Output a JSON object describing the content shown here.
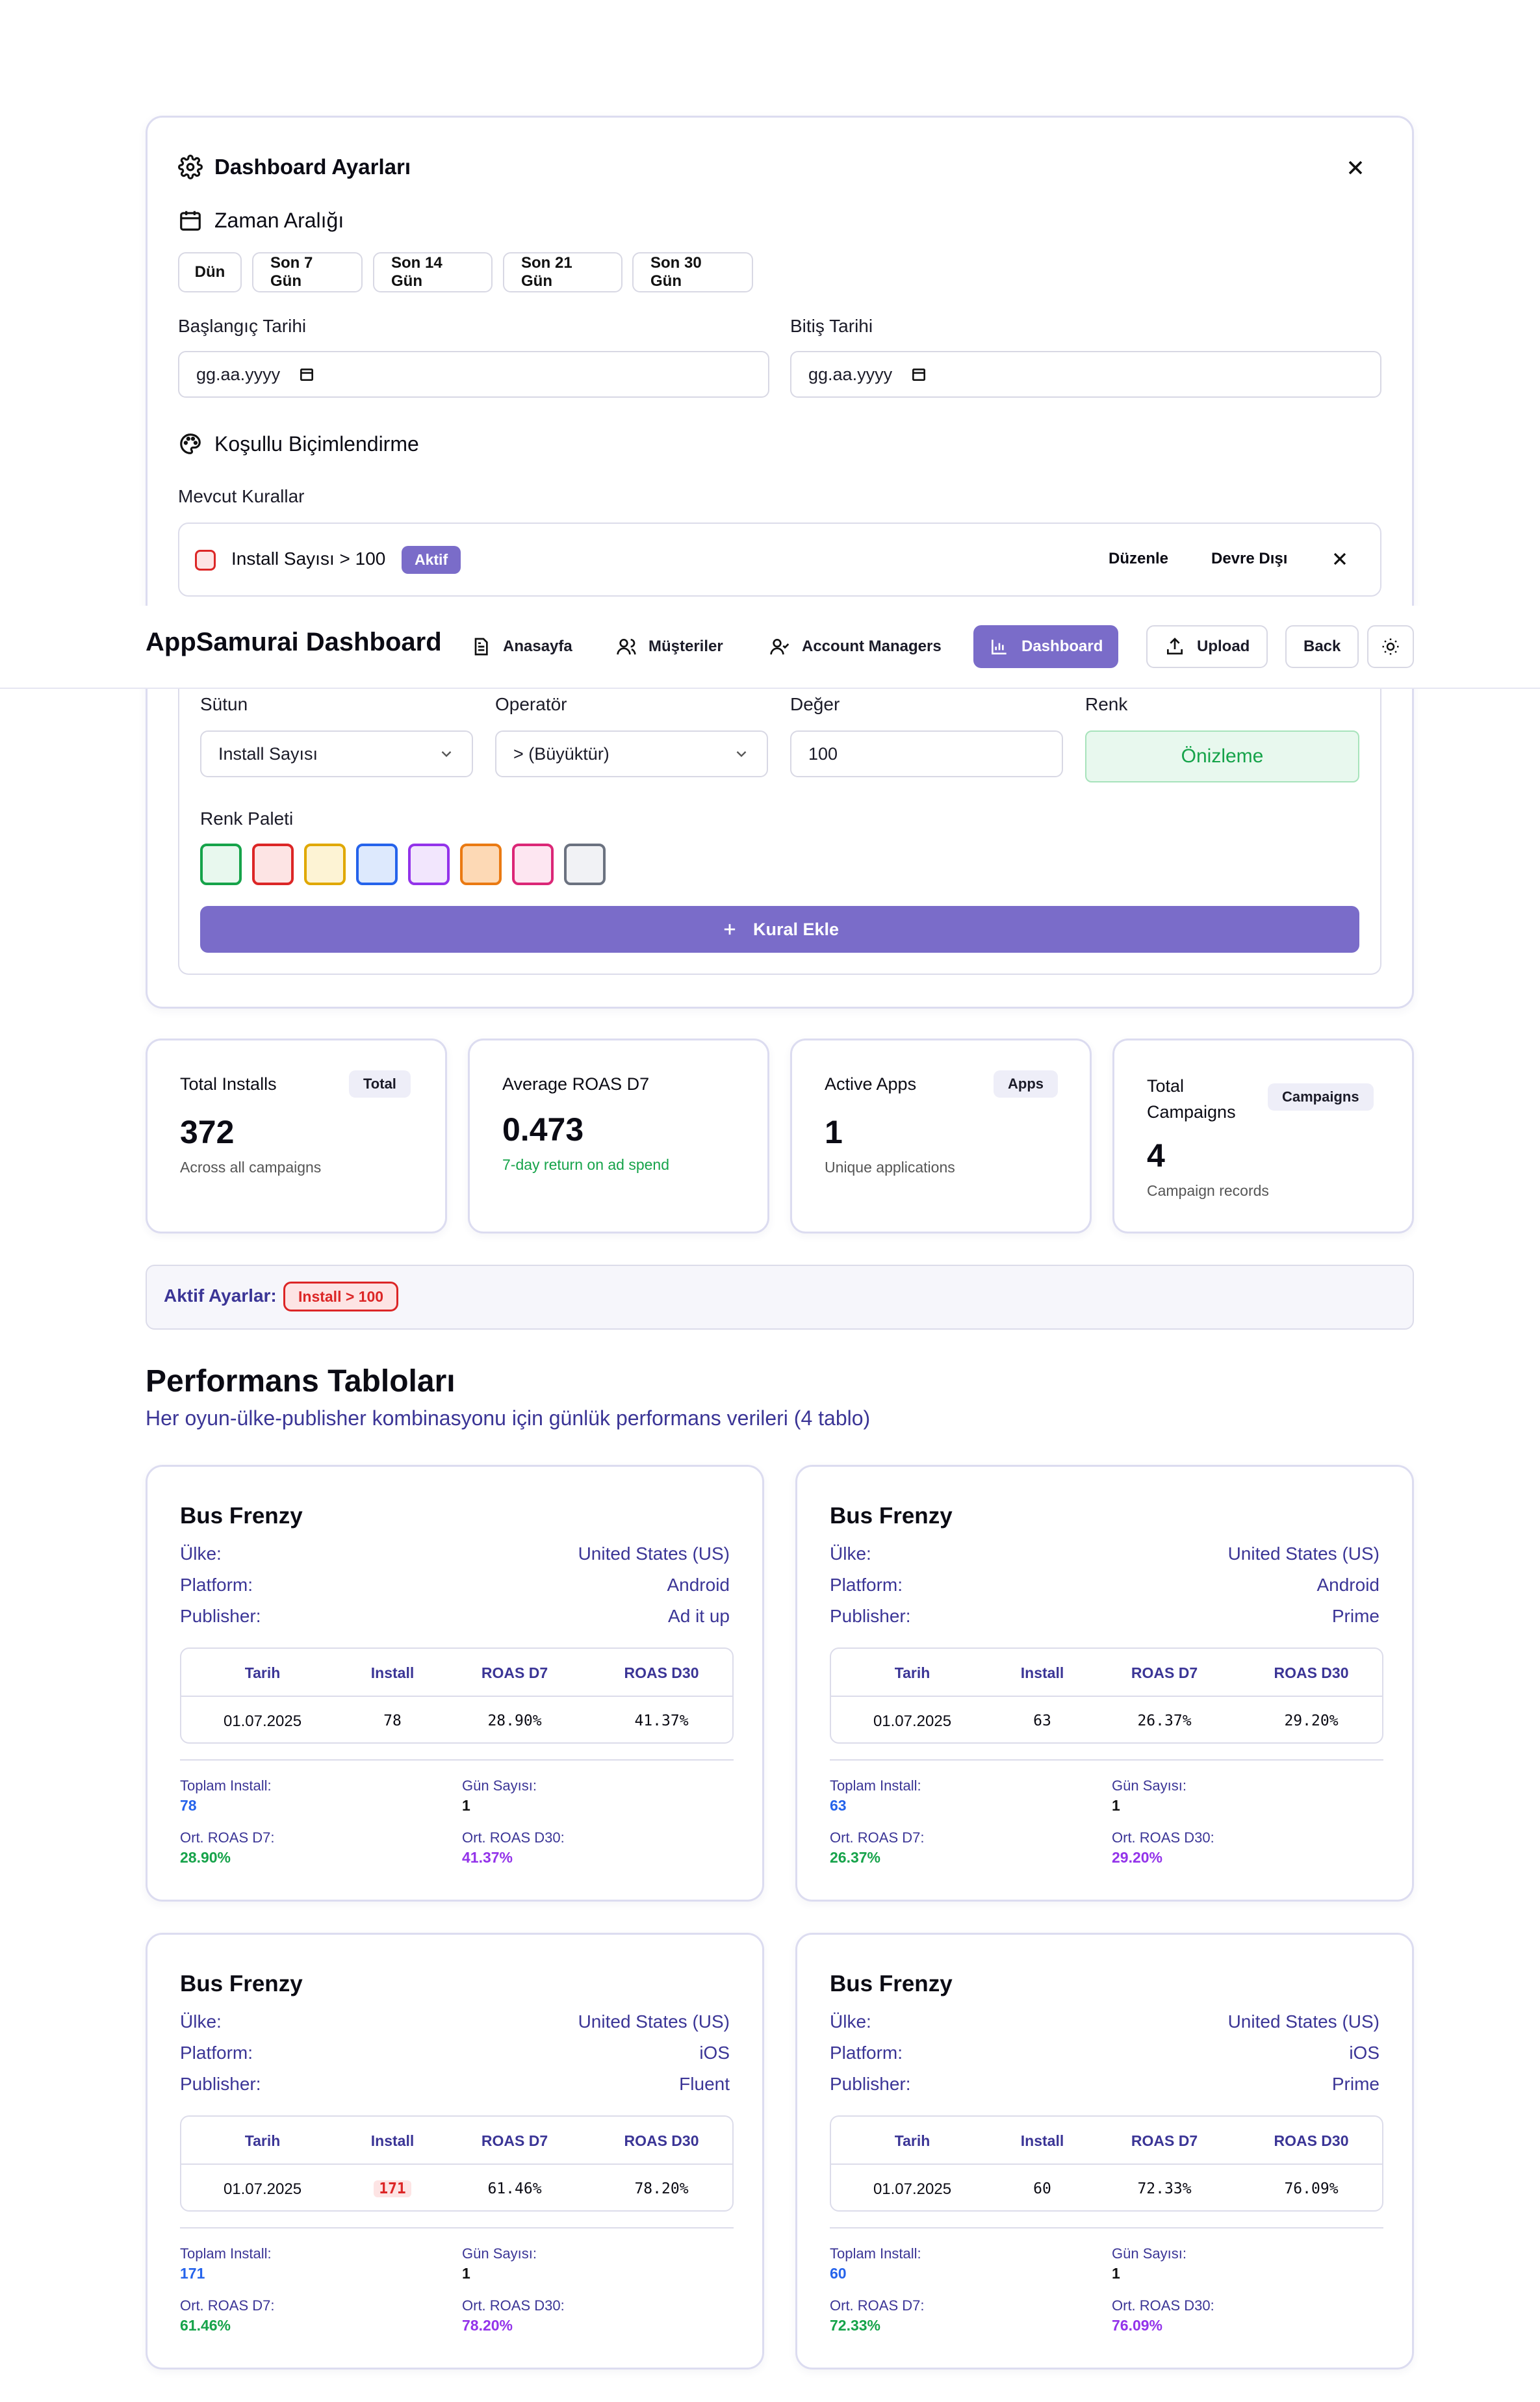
{
  "settings": {
    "title": "Dashboard Ayarları",
    "date_range": {
      "title": "Zaman Aralığı",
      "presets": [
        "Dün",
        "Son 7 Gün",
        "Son 14 Gün",
        "Son 21 Gün",
        "Son 30 Gün"
      ],
      "start_label": "Başlangıç Tarihi",
      "start_placeholder": "gg.aa.yyyy",
      "end_label": "Bitiş Tarihi",
      "end_placeholder": "gg.aa.yyyy"
    },
    "conditional": {
      "title": "Koşullu Biçimlendirme",
      "existing_title": "Mevcut Kurallar",
      "rule": {
        "text": "Install Sayısı > 100",
        "status": "Aktif",
        "edit": "Düzenle",
        "disable": "Devre Dışı",
        "color": "#dc2626"
      },
      "form": {
        "column_label": "Sütun",
        "column_value": "Install Sayısı",
        "operator_label": "Operatör",
        "operator_value": "> (Büyüktür)",
        "value_label": "Değer",
        "value_value": "100",
        "color_label": "Renk",
        "preview": "Önizleme",
        "palette_label": "Renk Paleti",
        "palette": [
          {
            "fill": "#e8f8ee",
            "stroke": "#16a34a"
          },
          {
            "fill": "#fde4e4",
            "stroke": "#dc2626"
          },
          {
            "fill": "#fdf3d4",
            "stroke": "#e0a800"
          },
          {
            "fill": "#dde9fd",
            "stroke": "#2563eb"
          },
          {
            "fill": "#f2e6fd",
            "stroke": "#9333ea"
          },
          {
            "fill": "#fdd9b5",
            "stroke": "#ea7a12"
          },
          {
            "fill": "#fde6f1",
            "stroke": "#db2777"
          },
          {
            "fill": "#f1f2f5",
            "stroke": "#6b7280"
          }
        ],
        "add_button": "Kural Ekle"
      }
    }
  },
  "nav": {
    "brand": "AppSamurai Dashboard",
    "items": [
      "Anasayfa",
      "Müşteriler",
      "Account Managers",
      "Dashboard"
    ],
    "upload": "Upload",
    "back": "Back"
  },
  "stats": [
    {
      "title": "Total Installs",
      "badge": "Total",
      "value": "372",
      "desc": "Across all campaigns"
    },
    {
      "title": "Average ROAS D7",
      "badge": "",
      "value": "0.473",
      "desc": "7-day return on ad spend"
    },
    {
      "title": "Active Apps",
      "badge": "Apps",
      "value": "1",
      "desc": "Unique applications"
    },
    {
      "title": "Total Campaigns",
      "badge": "Campaigns",
      "value": "4",
      "desc": "Campaign records"
    }
  ],
  "active_settings": {
    "label": "Aktif Ayarlar:",
    "chip": "Install > 100"
  },
  "performance": {
    "title": "Performans Tabloları",
    "subtitle": "Her oyun-ülke-publisher kombinasyonu için günlük performans verileri (4 tablo)",
    "labels": {
      "country": "Ülke:",
      "platform": "Platform:",
      "publisher": "Publisher:"
    },
    "headers": [
      "Tarih",
      "Install",
      "ROAS D7",
      "ROAS D30"
    ],
    "summary_labels": {
      "total_install": "Toplam Install:",
      "days": "Gün Sayısı:",
      "avg_d7": "Ort. ROAS D7:",
      "avg_d30": "Ort. ROAS D30:"
    },
    "tables": [
      {
        "game": "Bus Frenzy",
        "country": "United States (US)",
        "platform": "Android",
        "publisher": "Ad it up",
        "rows": [
          {
            "date": "01.07.2025",
            "install": "78",
            "d7": "28.90%",
            "d30": "41.37%"
          }
        ],
        "total_install": "78",
        "days": "1",
        "avg_d7": "28.90%",
        "avg_d30": "41.37%"
      },
      {
        "game": "Bus Frenzy",
        "country": "United States (US)",
        "platform": "Android",
        "publisher": "Prime",
        "rows": [
          {
            "date": "01.07.2025",
            "install": "63",
            "d7": "26.37%",
            "d30": "29.20%"
          }
        ],
        "total_install": "63",
        "days": "1",
        "avg_d7": "26.37%",
        "avg_d30": "29.20%"
      },
      {
        "game": "Bus Frenzy",
        "country": "United States (US)",
        "platform": "iOS",
        "publisher": "Fluent",
        "rows": [
          {
            "date": "01.07.2025",
            "install": "171",
            "d7": "61.46%",
            "d30": "78.20%"
          }
        ],
        "total_install": "171",
        "days": "1",
        "avg_d7": "61.46%",
        "avg_d30": "78.20%"
      },
      {
        "game": "Bus Frenzy",
        "country": "United States (US)",
        "platform": "iOS",
        "publisher": "Prime",
        "rows": [
          {
            "date": "01.07.2025",
            "install": "60",
            "d7": "72.33%",
            "d30": "76.09%"
          }
        ],
        "total_install": "60",
        "days": "1",
        "avg_d7": "72.33%",
        "avg_d30": "76.09%"
      }
    ]
  },
  "colors": {
    "accent": "#7a6cc9",
    "link": "#3b3596",
    "green": "#16a34a",
    "purple": "#9333ea",
    "blue": "#2563eb"
  }
}
